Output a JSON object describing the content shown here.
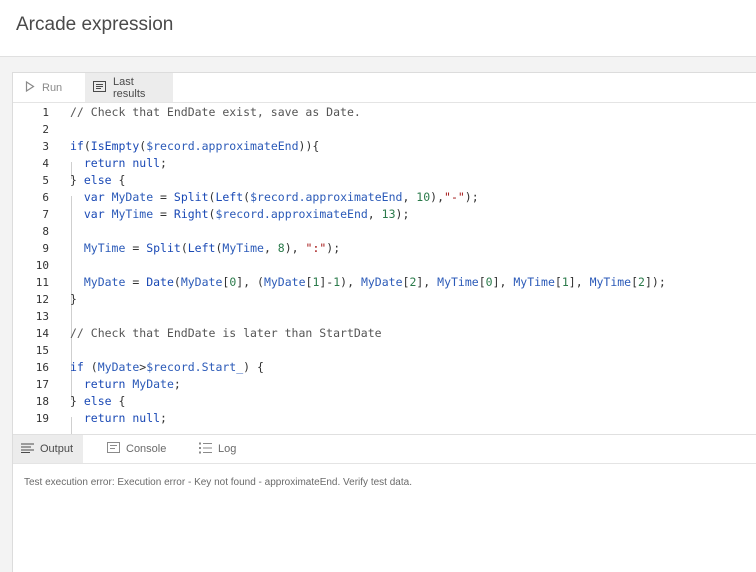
{
  "header": {
    "title": "Arcade expression"
  },
  "toolbar": {
    "run_label": "Run",
    "run_icon": "play-icon",
    "last_results_label": "Last results",
    "last_results_icon": "results-icon"
  },
  "editor": {
    "lines": [
      {
        "n": "1",
        "text": "// Check that EndDate exist, save as Date."
      },
      {
        "n": "2",
        "text": ""
      },
      {
        "n": "3",
        "text": "if(IsEmpty($record.approximateEnd)){"
      },
      {
        "n": "4",
        "text": "  return null;"
      },
      {
        "n": "5",
        "text": "} else {"
      },
      {
        "n": "6",
        "text": "  var MyDate = Split(Left($record.approximateEnd, 10),\"-\");"
      },
      {
        "n": "7",
        "text": "  var MyTime = Right($record.approximateEnd, 13);"
      },
      {
        "n": "8",
        "text": ""
      },
      {
        "n": "9",
        "text": "  MyTime = Split(Left(MyTime, 8), \":\");"
      },
      {
        "n": "10",
        "text": ""
      },
      {
        "n": "11",
        "text": "  MyDate = Date(MyDate[0], (MyDate[1]-1), MyDate[2], MyTime[0], MyTime[1], MyTime[2]);"
      },
      {
        "n": "12",
        "text": "}"
      },
      {
        "n": "13",
        "text": ""
      },
      {
        "n": "14",
        "text": "// Check that EndDate is later than StartDate"
      },
      {
        "n": "15",
        "text": ""
      },
      {
        "n": "16",
        "text": "if (MyDate>$record.Start_) {"
      },
      {
        "n": "17",
        "text": "  return MyDate;"
      },
      {
        "n": "18",
        "text": "} else {"
      },
      {
        "n": "19",
        "text": "  return null;"
      }
    ]
  },
  "output_tabs": {
    "output_label": "Output",
    "console_label": "Console",
    "log_label": "Log",
    "output_icon": "output-list-icon",
    "console_icon": "console-icon",
    "log_icon": "log-list-icon"
  },
  "output": {
    "message": "Test execution error: Execution error - Key not found - approximateEnd. Verify test data."
  },
  "colors": {
    "keyword": "#1a49b5",
    "string": "#a31515",
    "number": "#2a7a4a",
    "comment": "#555555"
  }
}
